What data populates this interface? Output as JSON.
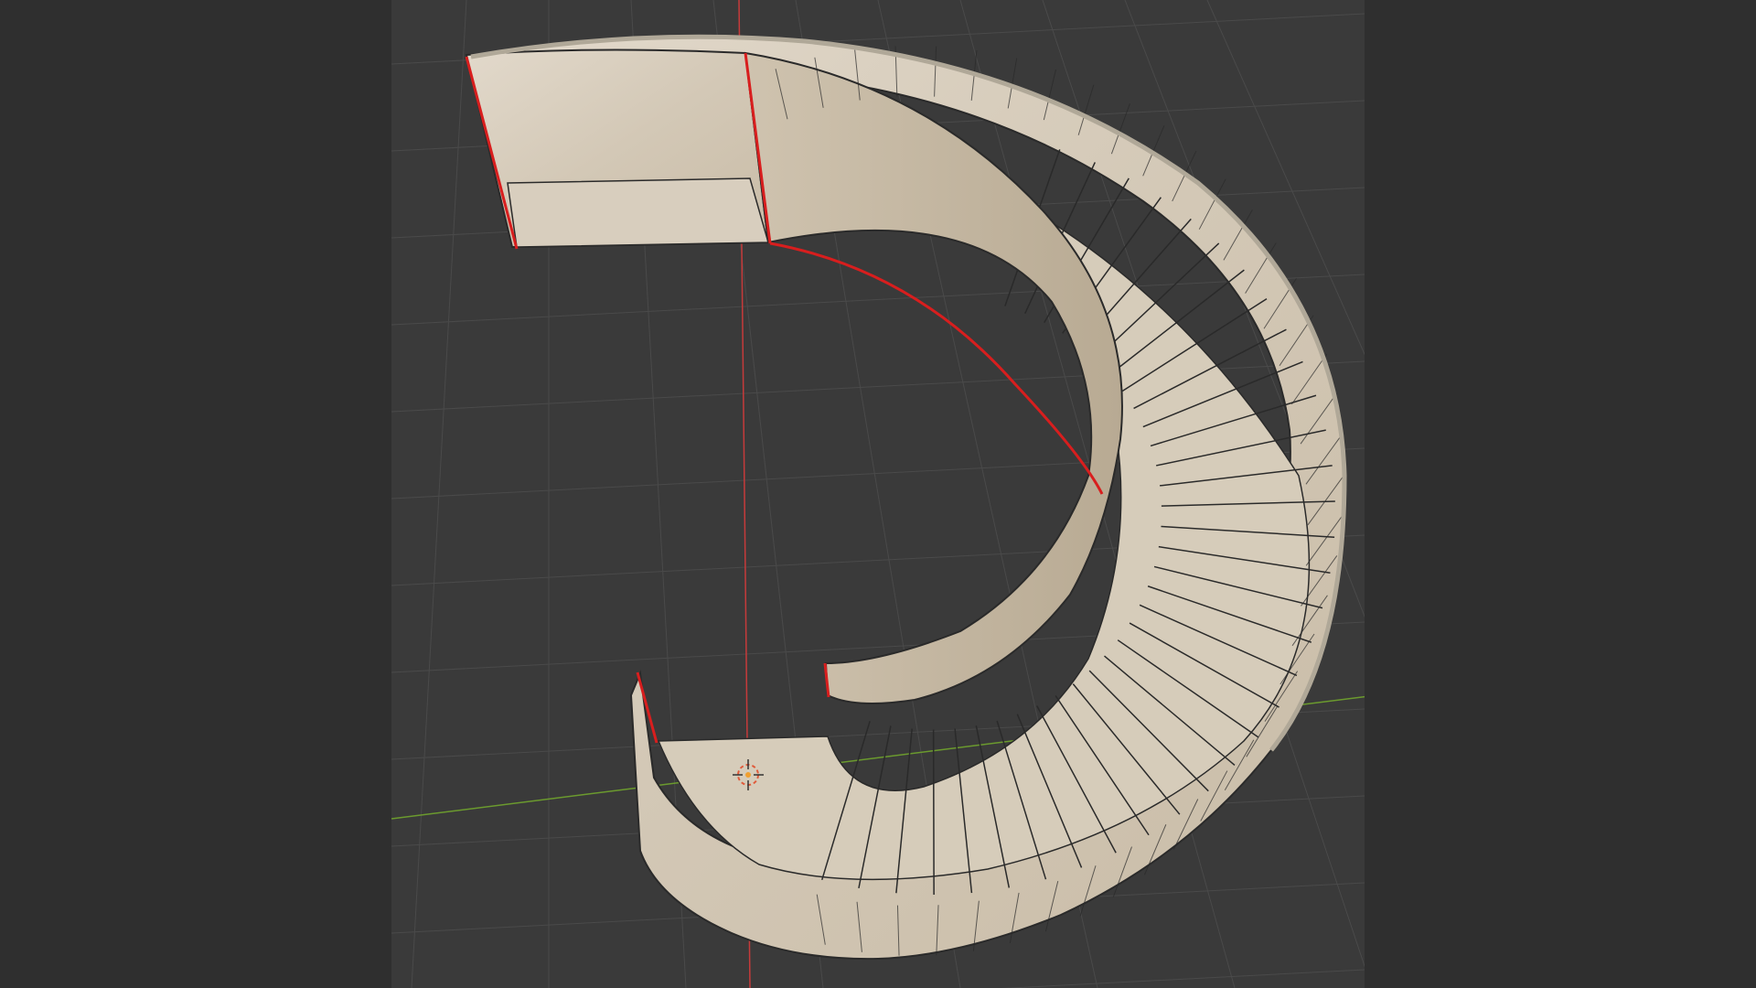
{
  "app": {
    "name": "3D viewport"
  },
  "viewport": {
    "background_color": "#3a3a3a",
    "letterbox_color": "#2f2f2f",
    "grid_color": "#4a4a4a",
    "x_axis_color": "#c63a3a",
    "y_axis_color": "#6b9a2e",
    "object": {
      "kind": "spiral staircase mesh",
      "material": "marble",
      "selected_edge_color": "#d81e1e",
      "wireframe_color": "#2a2a2a",
      "marble_light": "#ddd3c4",
      "marble_dark": "#a89880",
      "step_count_approx": 34
    },
    "origin_marker": {
      "icon": "3d-cursor-icon"
    }
  }
}
